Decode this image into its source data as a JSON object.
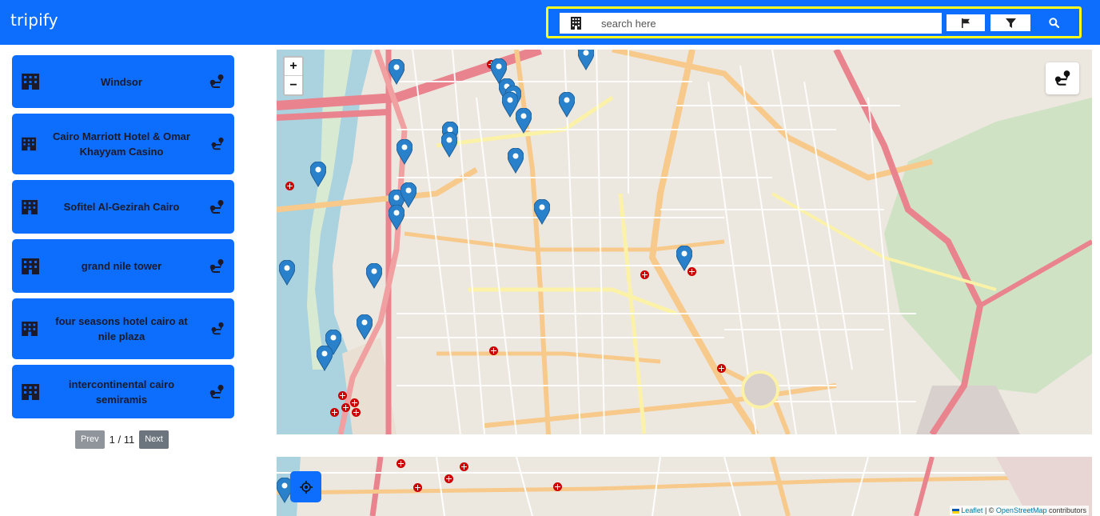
{
  "app": {
    "brand": "tripify"
  },
  "search": {
    "placeholder": "search here",
    "value": ""
  },
  "hotels": [
    {
      "name": "Windsor"
    },
    {
      "name": "Cairo Marriott Hotel & Omar Khayyam Casino"
    },
    {
      "name": "Sofitel Al-Gezirah Cairo"
    },
    {
      "name": "grand nile tower"
    },
    {
      "name": "four seasons hotel cairo at nile plaza"
    },
    {
      "name": "intercontinental cairo semiramis"
    }
  ],
  "pagination": {
    "prev_label": "Prev",
    "next_label": "Next",
    "current": "1",
    "total": "11",
    "info": "1 / 11"
  },
  "map": {
    "zoom_in": "+",
    "zoom_out": "−",
    "attribution": {
      "leaflet": "Leaflet",
      "separator": " | © ",
      "osm": "OpenStreetMap",
      "suffix": " contributors"
    }
  },
  "colors": {
    "primary": "#0d6efd",
    "highlight": "#ffff1f",
    "marker": "#2a81cb",
    "hospital": "#cc0000"
  },
  "icons": {
    "building": "building-icon",
    "route": "route-icon",
    "flag": "flag-icon",
    "filter": "filter-icon",
    "search": "search-icon",
    "locate": "crosshair-icon"
  }
}
